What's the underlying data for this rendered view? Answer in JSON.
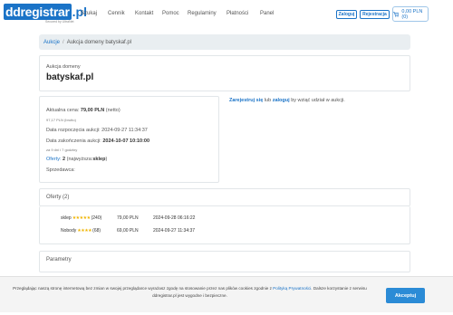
{
  "logo": {
    "name": "ddregistrar",
    "tld": ".pl",
    "tagline": "Secured by UltraNet"
  },
  "nav": [
    "Szukaj",
    "Cennik",
    "Kontakt",
    "Pomoc",
    "Regulaminy",
    "Płatności",
    "Panel"
  ],
  "header_buttons": {
    "login": "Zaloguj",
    "register": "Rejestracja",
    "cart": "0,00 PLN (0)"
  },
  "breadcrumb": {
    "root": "Aukcje",
    "separator": "/",
    "current": "Aukcja domeny batyskaf.pl"
  },
  "auction": {
    "label": "Aukcja domeny",
    "domain": "batyskaf.pl"
  },
  "info": {
    "current_price_label": "Aktualna cena:",
    "current_price": "79,00 PLN",
    "net": "(netto)",
    "gross": "97,17 PLN (brutto)",
    "start_label": "Data rozpoczęcia aukcji:",
    "start_value": "2024-09-27 11:34:37",
    "end_label": "Data zakończenia aukcji:",
    "end_value": "2024-10-07 10:10:00",
    "remaining": "za 9 dni i 7 godziny",
    "offers_label": "Oferty:",
    "offers_count": "2",
    "highest_label": "(najwyższa:",
    "highest_user": "sklep",
    "highest_close": ")",
    "seller_label": "Sprzedawca:"
  },
  "login_note": {
    "register": "Zarejestruj się",
    "or": "lub",
    "login": "zaloguj",
    "rest": "by wziąć udział w aukcji."
  },
  "offers_section": {
    "title": "Oferty (2)"
  },
  "offers": [
    {
      "user": "sklep",
      "stars": "★★★★★",
      "rating": "(240)",
      "price": "79,00 PLN",
      "date": "2024-09-28 06:16:22"
    },
    {
      "user": "Nobody",
      "stars": "★★★★",
      "rating": "(68)",
      "price": "69,00 PLN",
      "date": "2024-09-27 11:34:37"
    }
  ],
  "params_section": {
    "title": "Parametry"
  },
  "cookie": {
    "text_before": "Przeglądając naszą stronę internetową bez zmian w swojej przeglądarce wyrażasz zgodę na stosowanie przez nas plików cookies zgodnie z",
    "link": "Polityką Prywatności",
    "text_after": ". Dalsze korzystanie z serwisu ddregistrar.pl jest wygodne i bezpieczne.",
    "accept": "Akceptuj"
  },
  "colors": {
    "brand": "#1a73c7",
    "star": "#f0b400",
    "accept": "#2b8bd6"
  }
}
